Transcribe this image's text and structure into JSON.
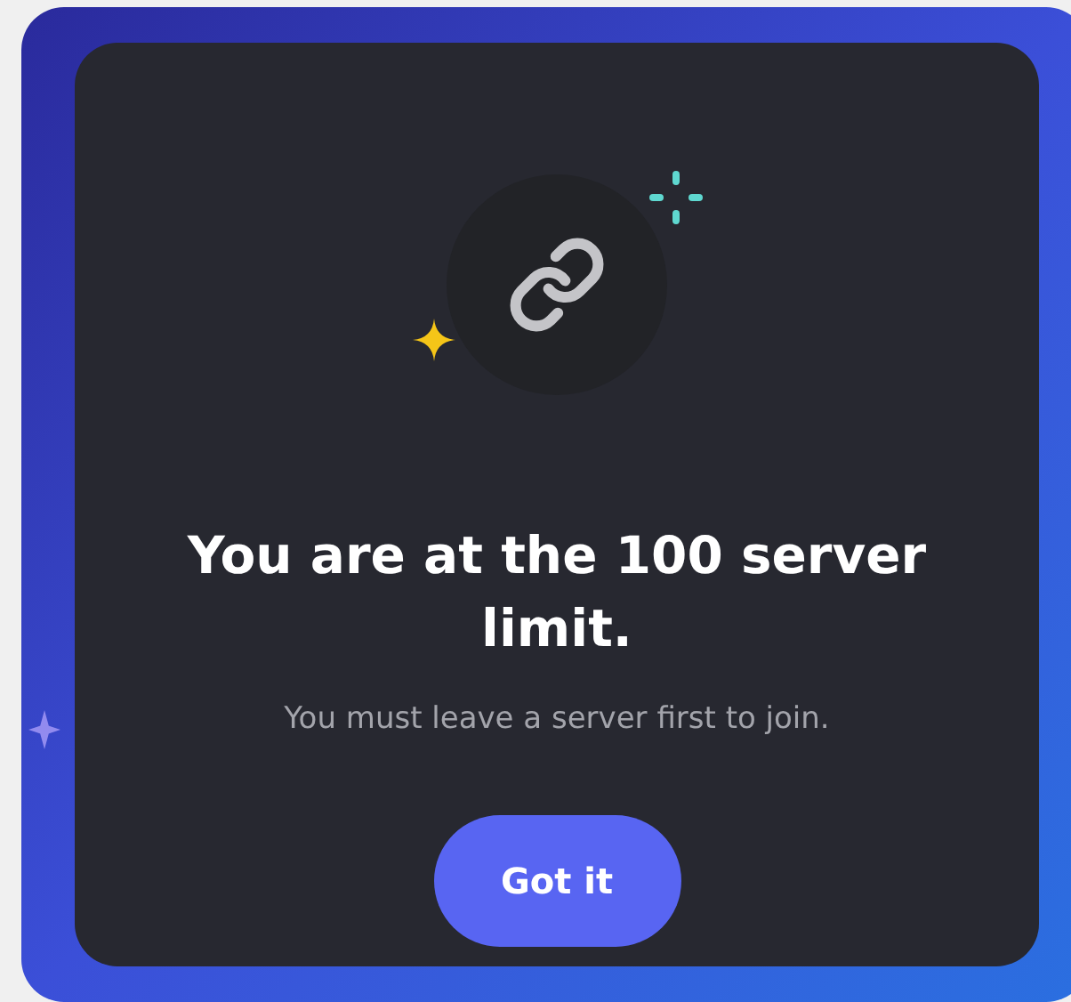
{
  "dialog": {
    "title": "You are at the 100 server limit.",
    "message": "You must leave a server first to join.",
    "button": "Got it"
  }
}
